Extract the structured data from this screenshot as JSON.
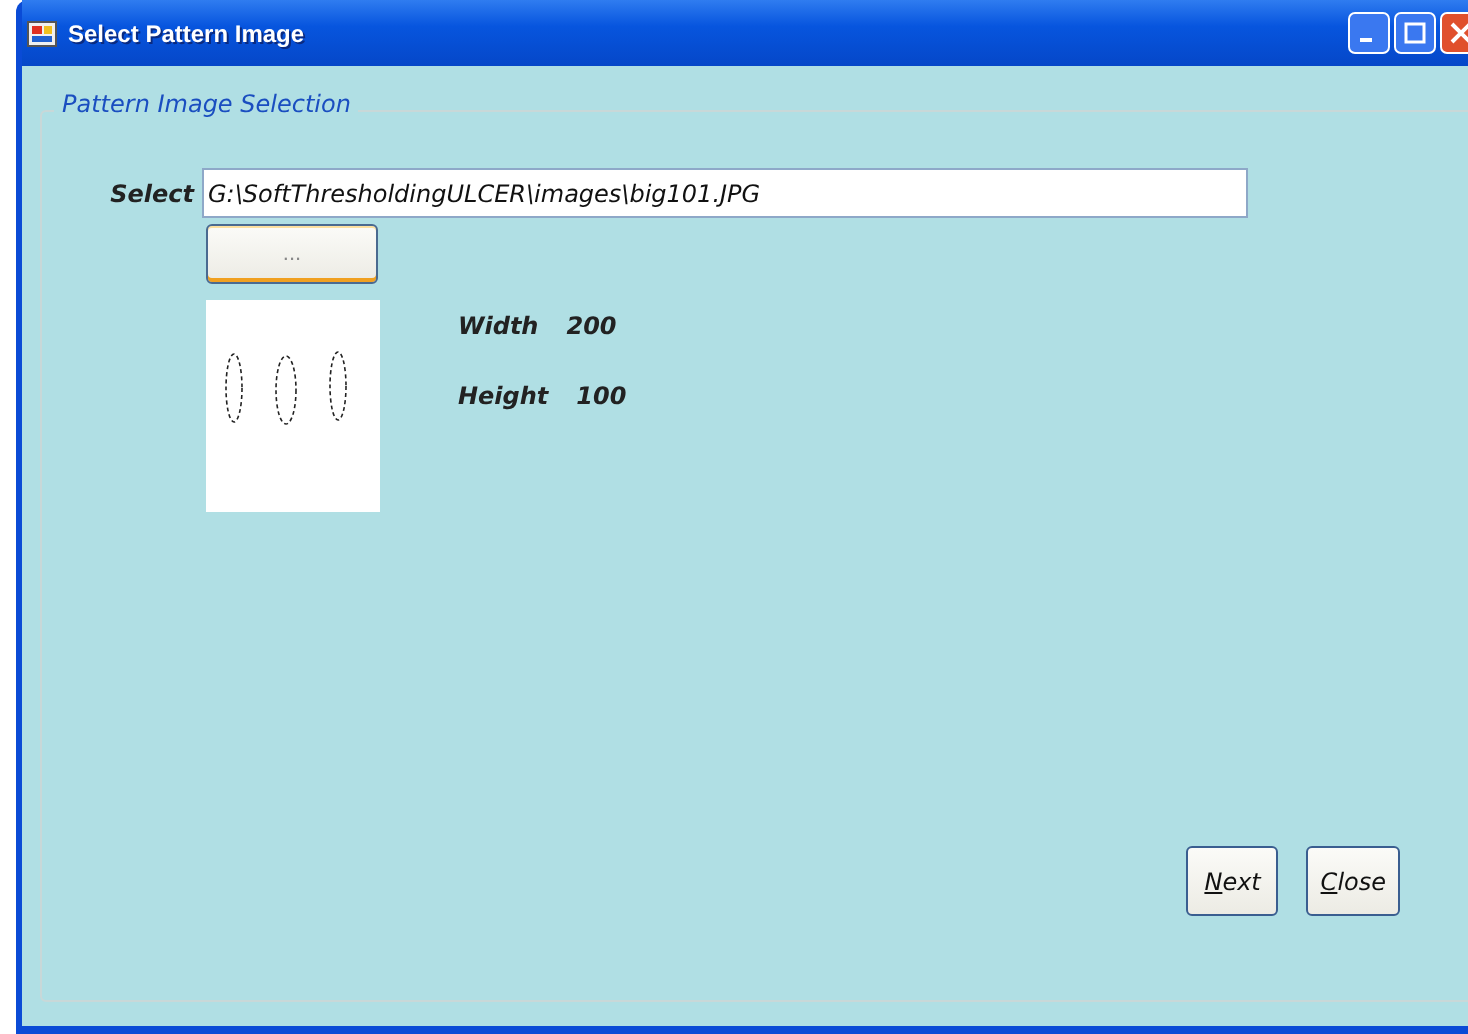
{
  "window": {
    "title": "Select Pattern Image"
  },
  "group": {
    "title": "Pattern Image Selection"
  },
  "select": {
    "label": "Select",
    "value": "G:\\SoftThresholdingULCER\\images\\big101.JPG"
  },
  "browse_button": {
    "label": "...",
    "focused": true
  },
  "info": [
    {
      "label": "Width",
      "value": "200"
    },
    {
      "label": "Height",
      "value": "100"
    }
  ],
  "buttons": [
    {
      "key": "N",
      "rest": "ext"
    },
    {
      "key": "C",
      "rest": "lose"
    }
  ]
}
